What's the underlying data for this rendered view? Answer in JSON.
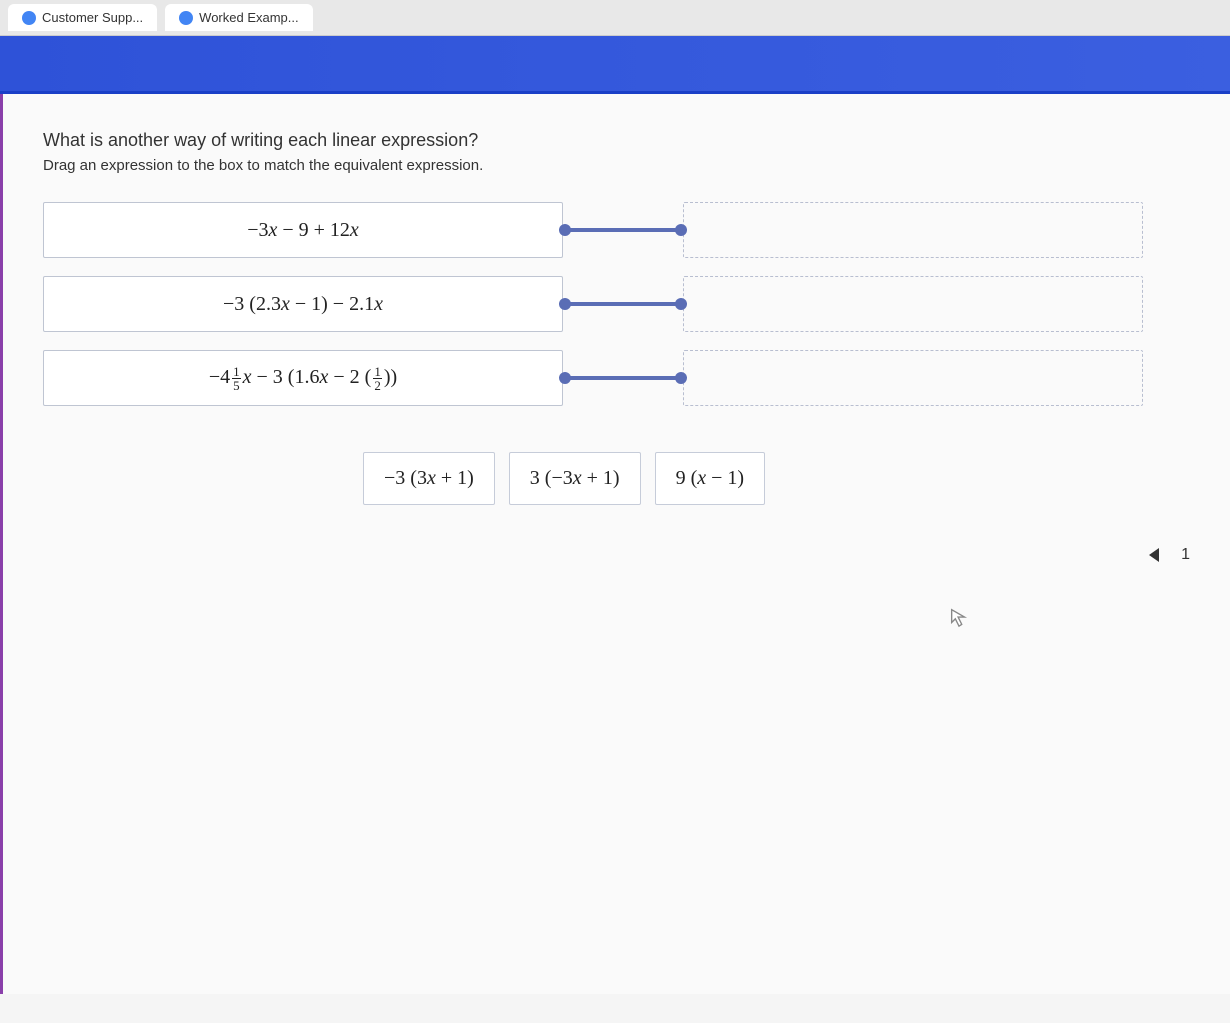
{
  "tabs": {
    "customer": "Customer Supp...",
    "worked": "Worked Examp..."
  },
  "question_title": "What is another way of writing each linear expression?",
  "instruction": "Drag an expression to the box to match the equivalent expression.",
  "expressions": {
    "row1": "−3x − 9 + 12x",
    "row2": "−3 (2.3x − 1) − 2.1x",
    "row3_prefix": "−4",
    "row3_frac_num": "1",
    "row3_frac_den": "5",
    "row3_mid": "x − 3 (1.6x − 2 (",
    "row3_inner_num": "1",
    "row3_inner_den": "2",
    "row3_suffix": "))"
  },
  "options": {
    "a": "−3 (3x + 1)",
    "b": "3 (−3x + 1)",
    "c": "9 (x − 1)"
  },
  "nav": {
    "page": "1"
  },
  "cursor_glyph": "↖"
}
